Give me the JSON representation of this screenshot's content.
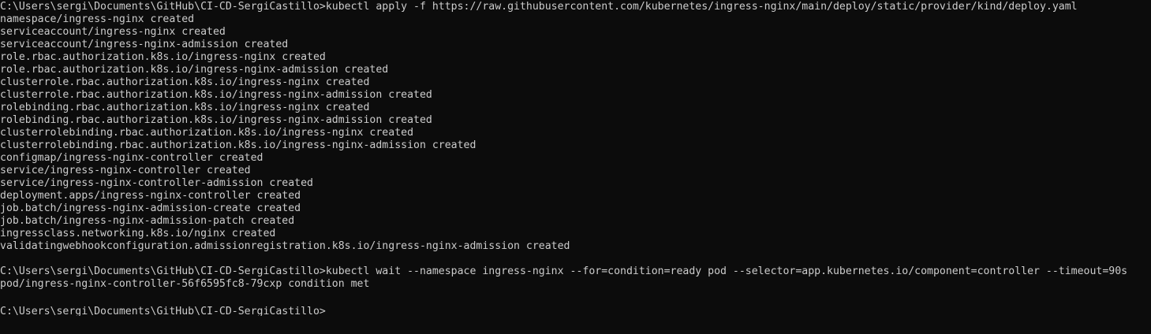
{
  "colors": {
    "background": "#0c0c0c",
    "foreground": "#cccccc"
  },
  "terminal": {
    "lines": [
      "C:\\Users\\sergi\\Documents\\GitHub\\CI-CD-SergiCastillo>kubectl apply -f https://raw.githubusercontent.com/kubernetes/ingress-nginx/main/deploy/static/provider/kind/deploy.yaml",
      "namespace/ingress-nginx created",
      "serviceaccount/ingress-nginx created",
      "serviceaccount/ingress-nginx-admission created",
      "role.rbac.authorization.k8s.io/ingress-nginx created",
      "role.rbac.authorization.k8s.io/ingress-nginx-admission created",
      "clusterrole.rbac.authorization.k8s.io/ingress-nginx created",
      "clusterrole.rbac.authorization.k8s.io/ingress-nginx-admission created",
      "rolebinding.rbac.authorization.k8s.io/ingress-nginx created",
      "rolebinding.rbac.authorization.k8s.io/ingress-nginx-admission created",
      "clusterrolebinding.rbac.authorization.k8s.io/ingress-nginx created",
      "clusterrolebinding.rbac.authorization.k8s.io/ingress-nginx-admission created",
      "configmap/ingress-nginx-controller created",
      "service/ingress-nginx-controller created",
      "service/ingress-nginx-controller-admission created",
      "deployment.apps/ingress-nginx-controller created",
      "job.batch/ingress-nginx-admission-create created",
      "job.batch/ingress-nginx-admission-patch created",
      "ingressclass.networking.k8s.io/nginx created",
      "validatingwebhookconfiguration.admissionregistration.k8s.io/ingress-nginx-admission created",
      "",
      "C:\\Users\\sergi\\Documents\\GitHub\\CI-CD-SergiCastillo>kubectl wait --namespace ingress-nginx --for=condition=ready pod --selector=app.kubernetes.io/component=controller --timeout=90s",
      "pod/ingress-nginx-controller-56f6595fc8-79cxp condition met",
      "",
      "C:\\Users\\sergi\\Documents\\GitHub\\CI-CD-SergiCastillo>"
    ]
  }
}
